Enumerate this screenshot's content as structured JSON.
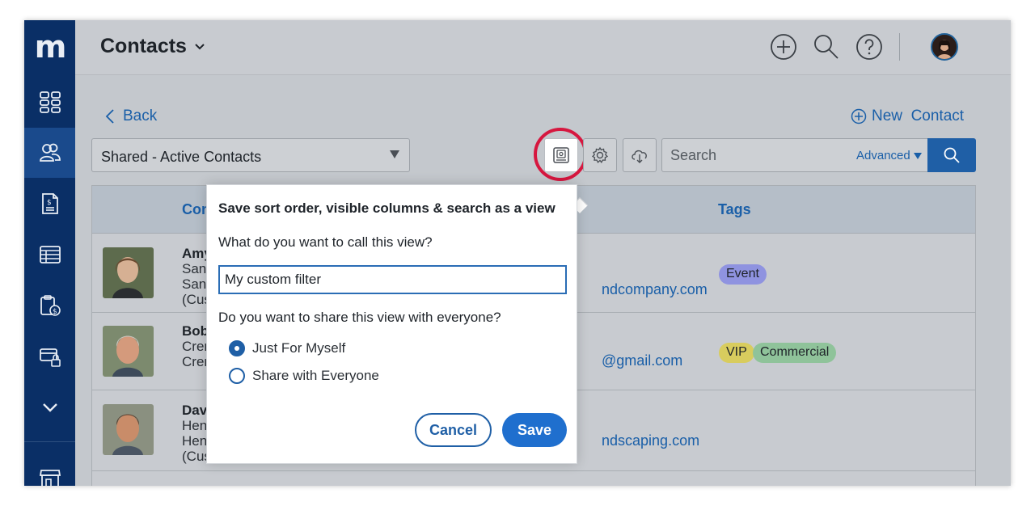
{
  "app": {
    "logo": "m"
  },
  "sidebar": {
    "items": [
      {
        "icon": "dashboard-icon"
      },
      {
        "icon": "contacts-icon",
        "active": true
      },
      {
        "icon": "invoice-icon"
      },
      {
        "icon": "list-icon"
      },
      {
        "icon": "billing-icon"
      },
      {
        "icon": "lock-card-icon"
      },
      {
        "icon": "chevron-down-icon"
      },
      {
        "icon": "store-icon"
      }
    ]
  },
  "header": {
    "title": "Contacts",
    "icons": [
      "add-circle-icon",
      "search-icon",
      "help-icon",
      "avatar"
    ]
  },
  "toolbar": {
    "back_label": "Back",
    "new_contact_label": "New  Contact",
    "view_selected": "Shared - Active Contacts",
    "search_placeholder": "Search",
    "advanced_label": "Advanced"
  },
  "table": {
    "columns": [
      "Con",
      "Tags"
    ],
    "rows": [
      {
        "name": "Amy",
        "lines": [
          "Sant",
          "Sant",
          "(Cus"
        ],
        "email": "ndcompany.com",
        "tags": [
          "Event"
        ]
      },
      {
        "name": "Bob",
        "lines": [
          "Cren",
          "Cren"
        ],
        "email": "@gmail.com",
        "tags": [
          "VIP",
          "Commercial"
        ]
      },
      {
        "name": "Dav",
        "lines": [
          "Hen",
          "Hen",
          "(Customer)"
        ],
        "email": "ndscaping.com",
        "tags": []
      }
    ]
  },
  "dialog": {
    "title": "Save sort order, visible columns & search as a view",
    "name_question": "What do you want to call this view?",
    "name_value": "My custom filter",
    "share_question": "Do you want to share this view with everyone?",
    "options": [
      {
        "label": "Just For Myself",
        "checked": true
      },
      {
        "label": "Share with Everyone",
        "checked": false
      }
    ],
    "cancel_label": "Cancel",
    "save_label": "Save"
  },
  "colors": {
    "sidebar": "#0a2f66",
    "accent": "#1f5fa6",
    "highlight": "#d6173f",
    "tag_event": "#8f93e0",
    "tag_vip": "#d8cc5e",
    "tag_commercial": "#8fc39a"
  }
}
